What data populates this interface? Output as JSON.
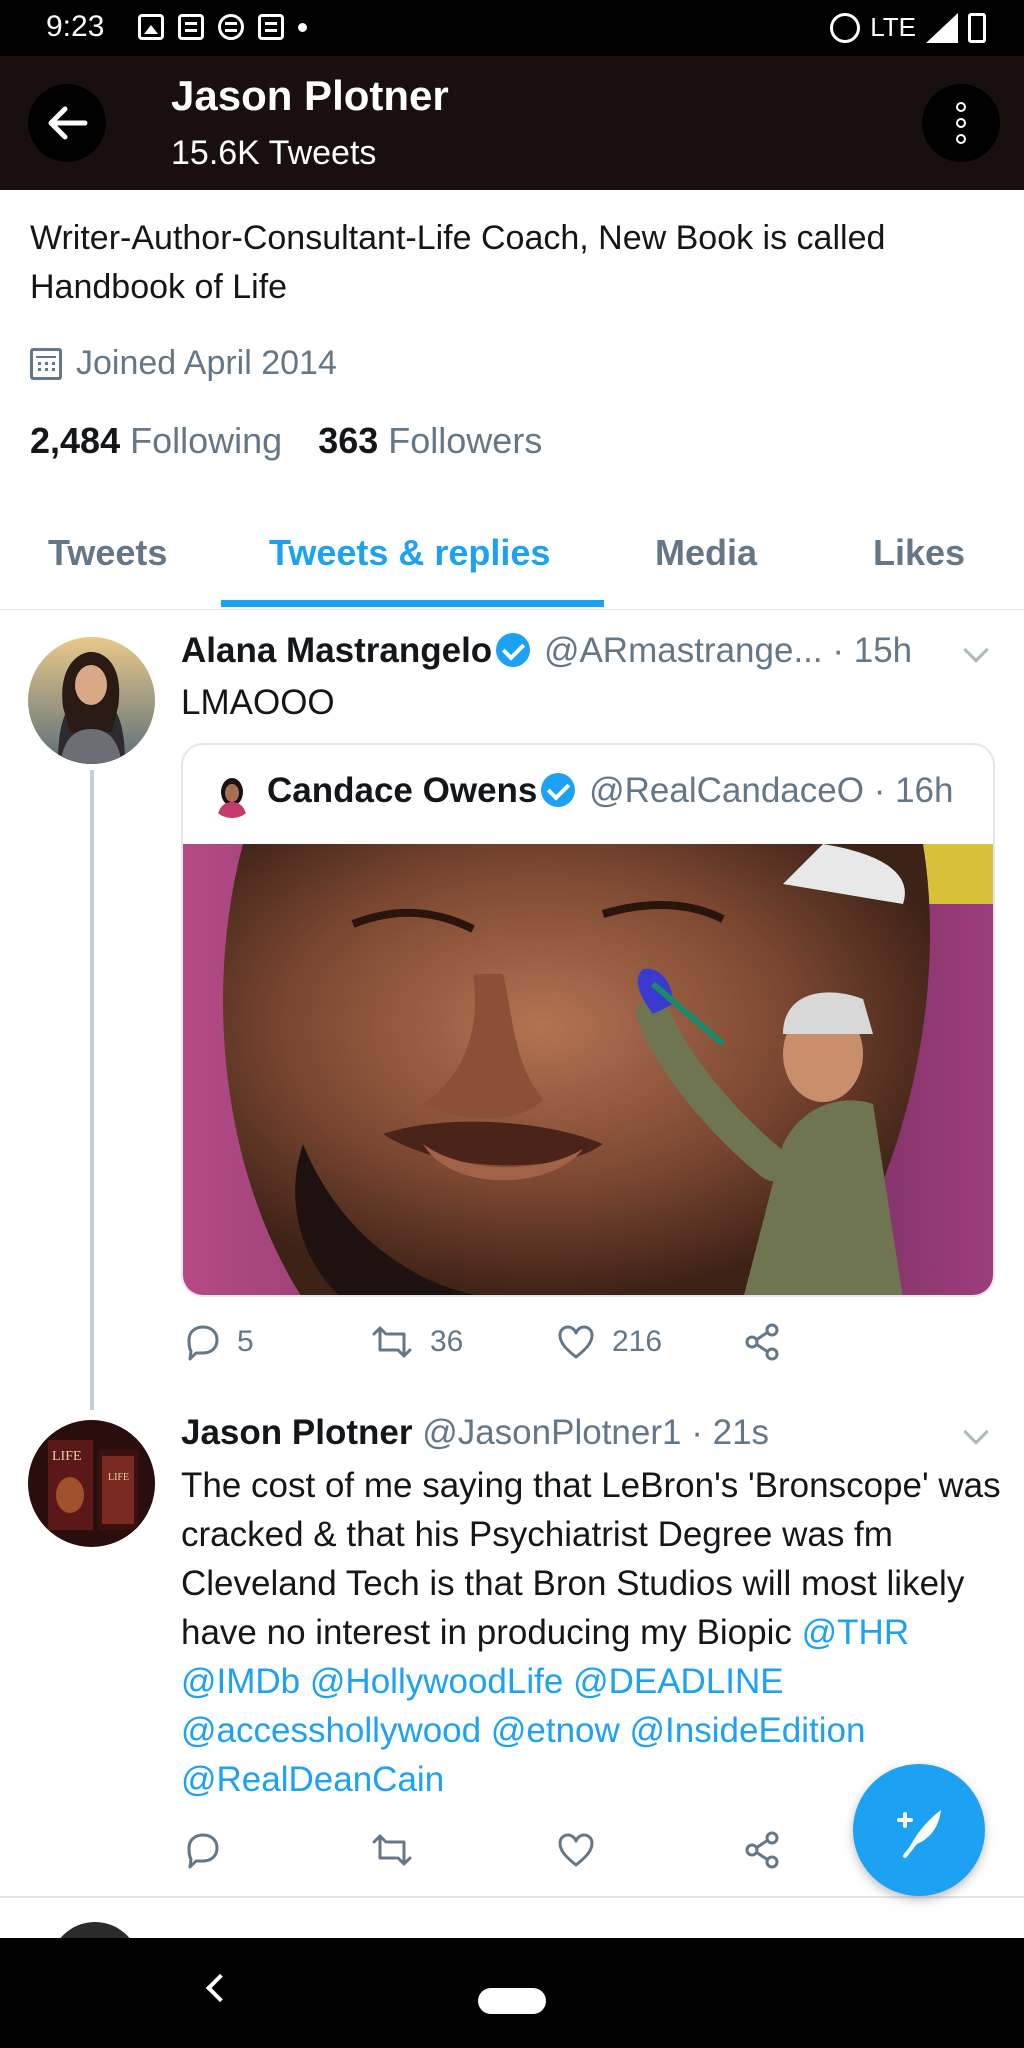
{
  "status_bar": {
    "time": "9:23",
    "network": "LTE"
  },
  "header": {
    "name": "Jason Plotner",
    "tweet_count": "15.6K Tweets"
  },
  "profile": {
    "bio": "Writer-Author-Consultant-Life Coach, New Book is called Handbook of Life",
    "joined": "Joined April 2014",
    "following_count": "2,484",
    "following_label": "Following",
    "followers_count": "363",
    "followers_label": "Followers"
  },
  "tabs": [
    {
      "label": "Tweets"
    },
    {
      "label": "Tweets & replies"
    },
    {
      "label": "Media"
    },
    {
      "label": "Likes"
    }
  ],
  "tweets": [
    {
      "name": "Alana Mastrangelo",
      "handle": "@ARmastrange...",
      "time": "· 15h",
      "text": "LMAOOO",
      "quote": {
        "name": "Candace Owens",
        "handle": "@RealCandaceO",
        "time": "· 16h"
      },
      "replies": "5",
      "retweets": "36",
      "likes": "216"
    },
    {
      "name": "Jason Plotner",
      "handle": "@JasonPlotner1",
      "time": "· 21s",
      "text": "The cost of me saying that LeBron's 'Bronscope' was cracked & that his Psychiatrist Degree was fm Cleveland Tech is that Bron Studios will most likely have no interest in producing my Biopic",
      "mentions": [
        "@THR",
        "@IMDb",
        "@HollywoodLife",
        "@DEADLINE",
        "@accesshollywood",
        "@etnow",
        "@InsideEdition",
        "@RealDeanCain"
      ]
    }
  ],
  "colors": {
    "accent": "#1da1f2",
    "header_bg": "#1a0f0f",
    "muted": "#657786"
  }
}
